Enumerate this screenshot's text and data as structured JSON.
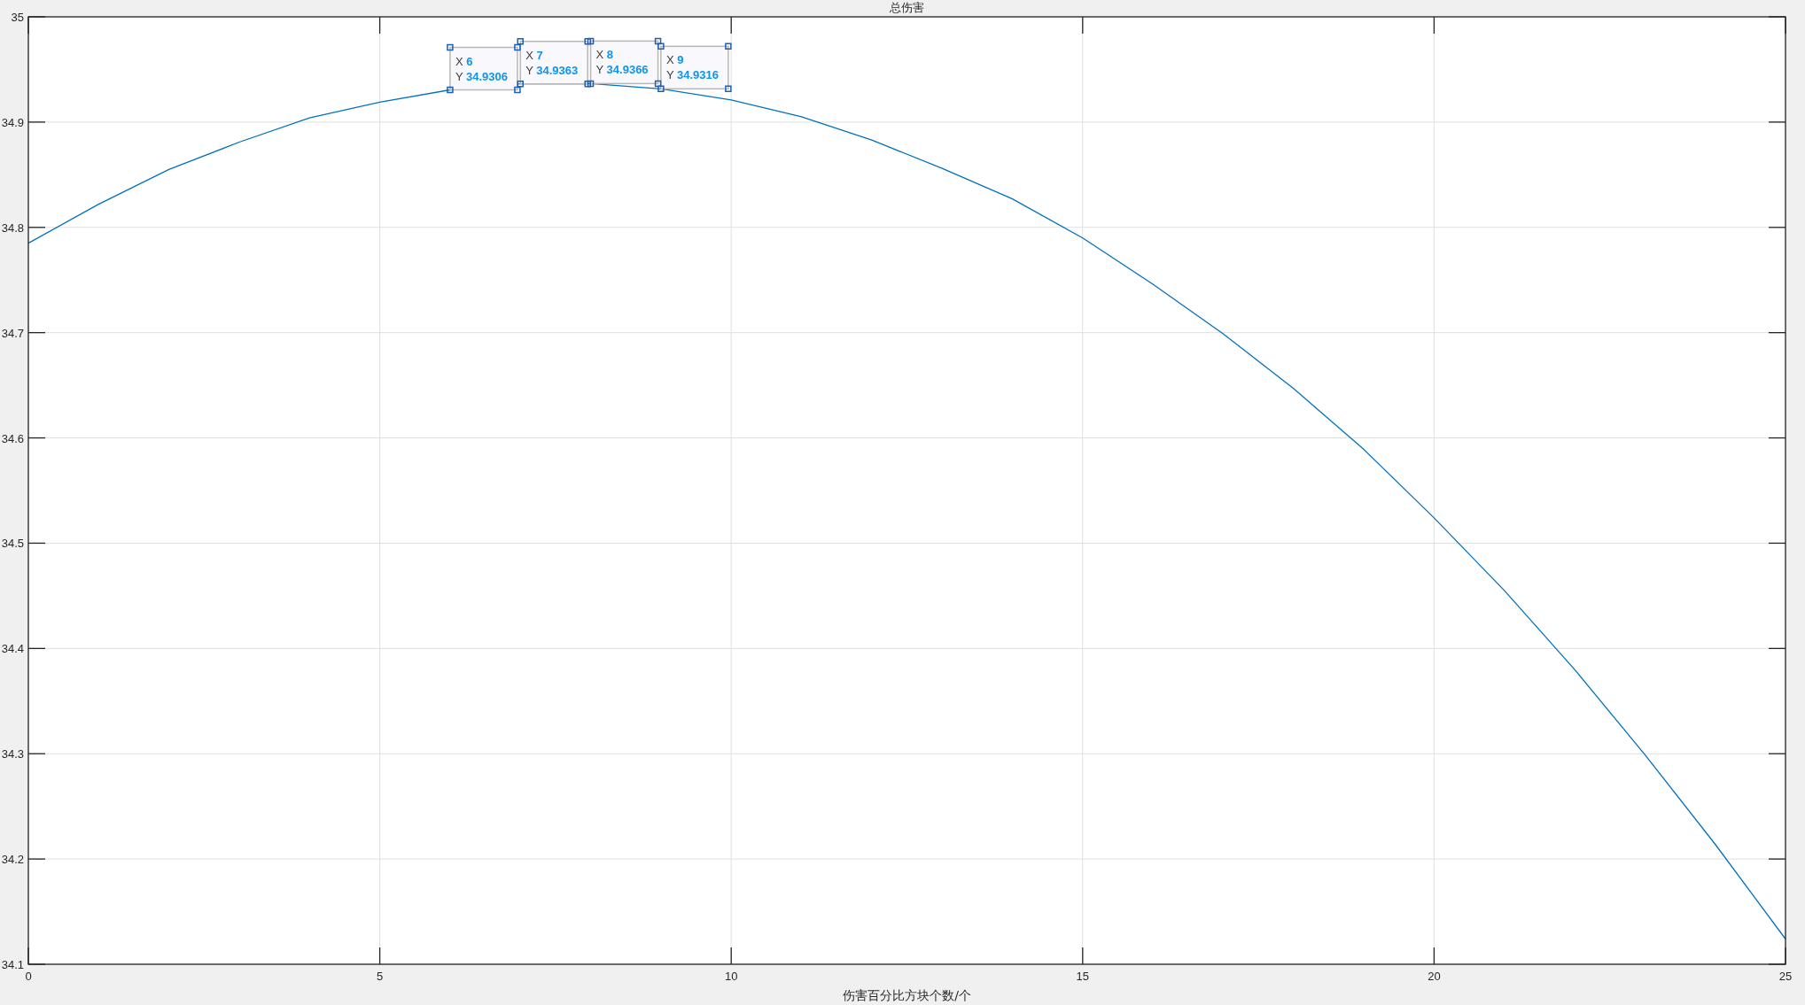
{
  "figure": {
    "chart_data": {
      "type": "line",
      "title": "总伤害",
      "xlabel": "伤害百分比方块个数/个",
      "grid": true,
      "xlim": [
        0,
        25
      ],
      "ylim": [
        34.1,
        35
      ],
      "xticks": [
        0,
        5,
        10,
        15,
        20,
        25
      ],
      "yticks": [
        {
          "value": 34.1,
          "label": "34.1"
        },
        {
          "value": 34.2,
          "label": "34.2"
        },
        {
          "value": 34.3,
          "label": "34.3"
        },
        {
          "value": 34.4,
          "label": "34.4"
        },
        {
          "value": 34.5,
          "label": "34.5"
        },
        {
          "value": 34.6,
          "label": "34.6"
        },
        {
          "value": 34.7,
          "label": "34.7"
        },
        {
          "value": 34.8,
          "label": "34.8"
        },
        {
          "value": 34.9,
          "label": "34.9"
        },
        {
          "value": 35,
          "label": "35"
        }
      ],
      "x": [
        0,
        1,
        2,
        3,
        4,
        5,
        6,
        7,
        8,
        9,
        10,
        11,
        12,
        13,
        14,
        15,
        16,
        17,
        18,
        19,
        20,
        21,
        22,
        23,
        24,
        25
      ],
      "series": [
        {
          "color": "#0072bd",
          "values": [
            34.785,
            34.822,
            34.855,
            34.881,
            34.904,
            34.919,
            34.9306,
            34.9363,
            34.9366,
            34.9316,
            34.921,
            34.905,
            34.883,
            34.856,
            34.827,
            34.79,
            34.746,
            34.699,
            34.647,
            34.589,
            34.524,
            34.455,
            34.38,
            34.299,
            34.214,
            34.124
          ]
        }
      ],
      "annotations": [
        {
          "x": 6,
          "y": 34.9306,
          "text": "X **6**\nY **34.9306**"
        },
        {
          "x": 7,
          "y": 34.9363,
          "text": "X **7**\nY **34.9363**"
        },
        {
          "x": 8,
          "y": 34.9366,
          "text": "X **8**\nY **34.9366**"
        },
        {
          "x": 9,
          "y": 34.9316,
          "text": "X **9**\nY **34.9316**"
        }
      ]
    }
  }
}
